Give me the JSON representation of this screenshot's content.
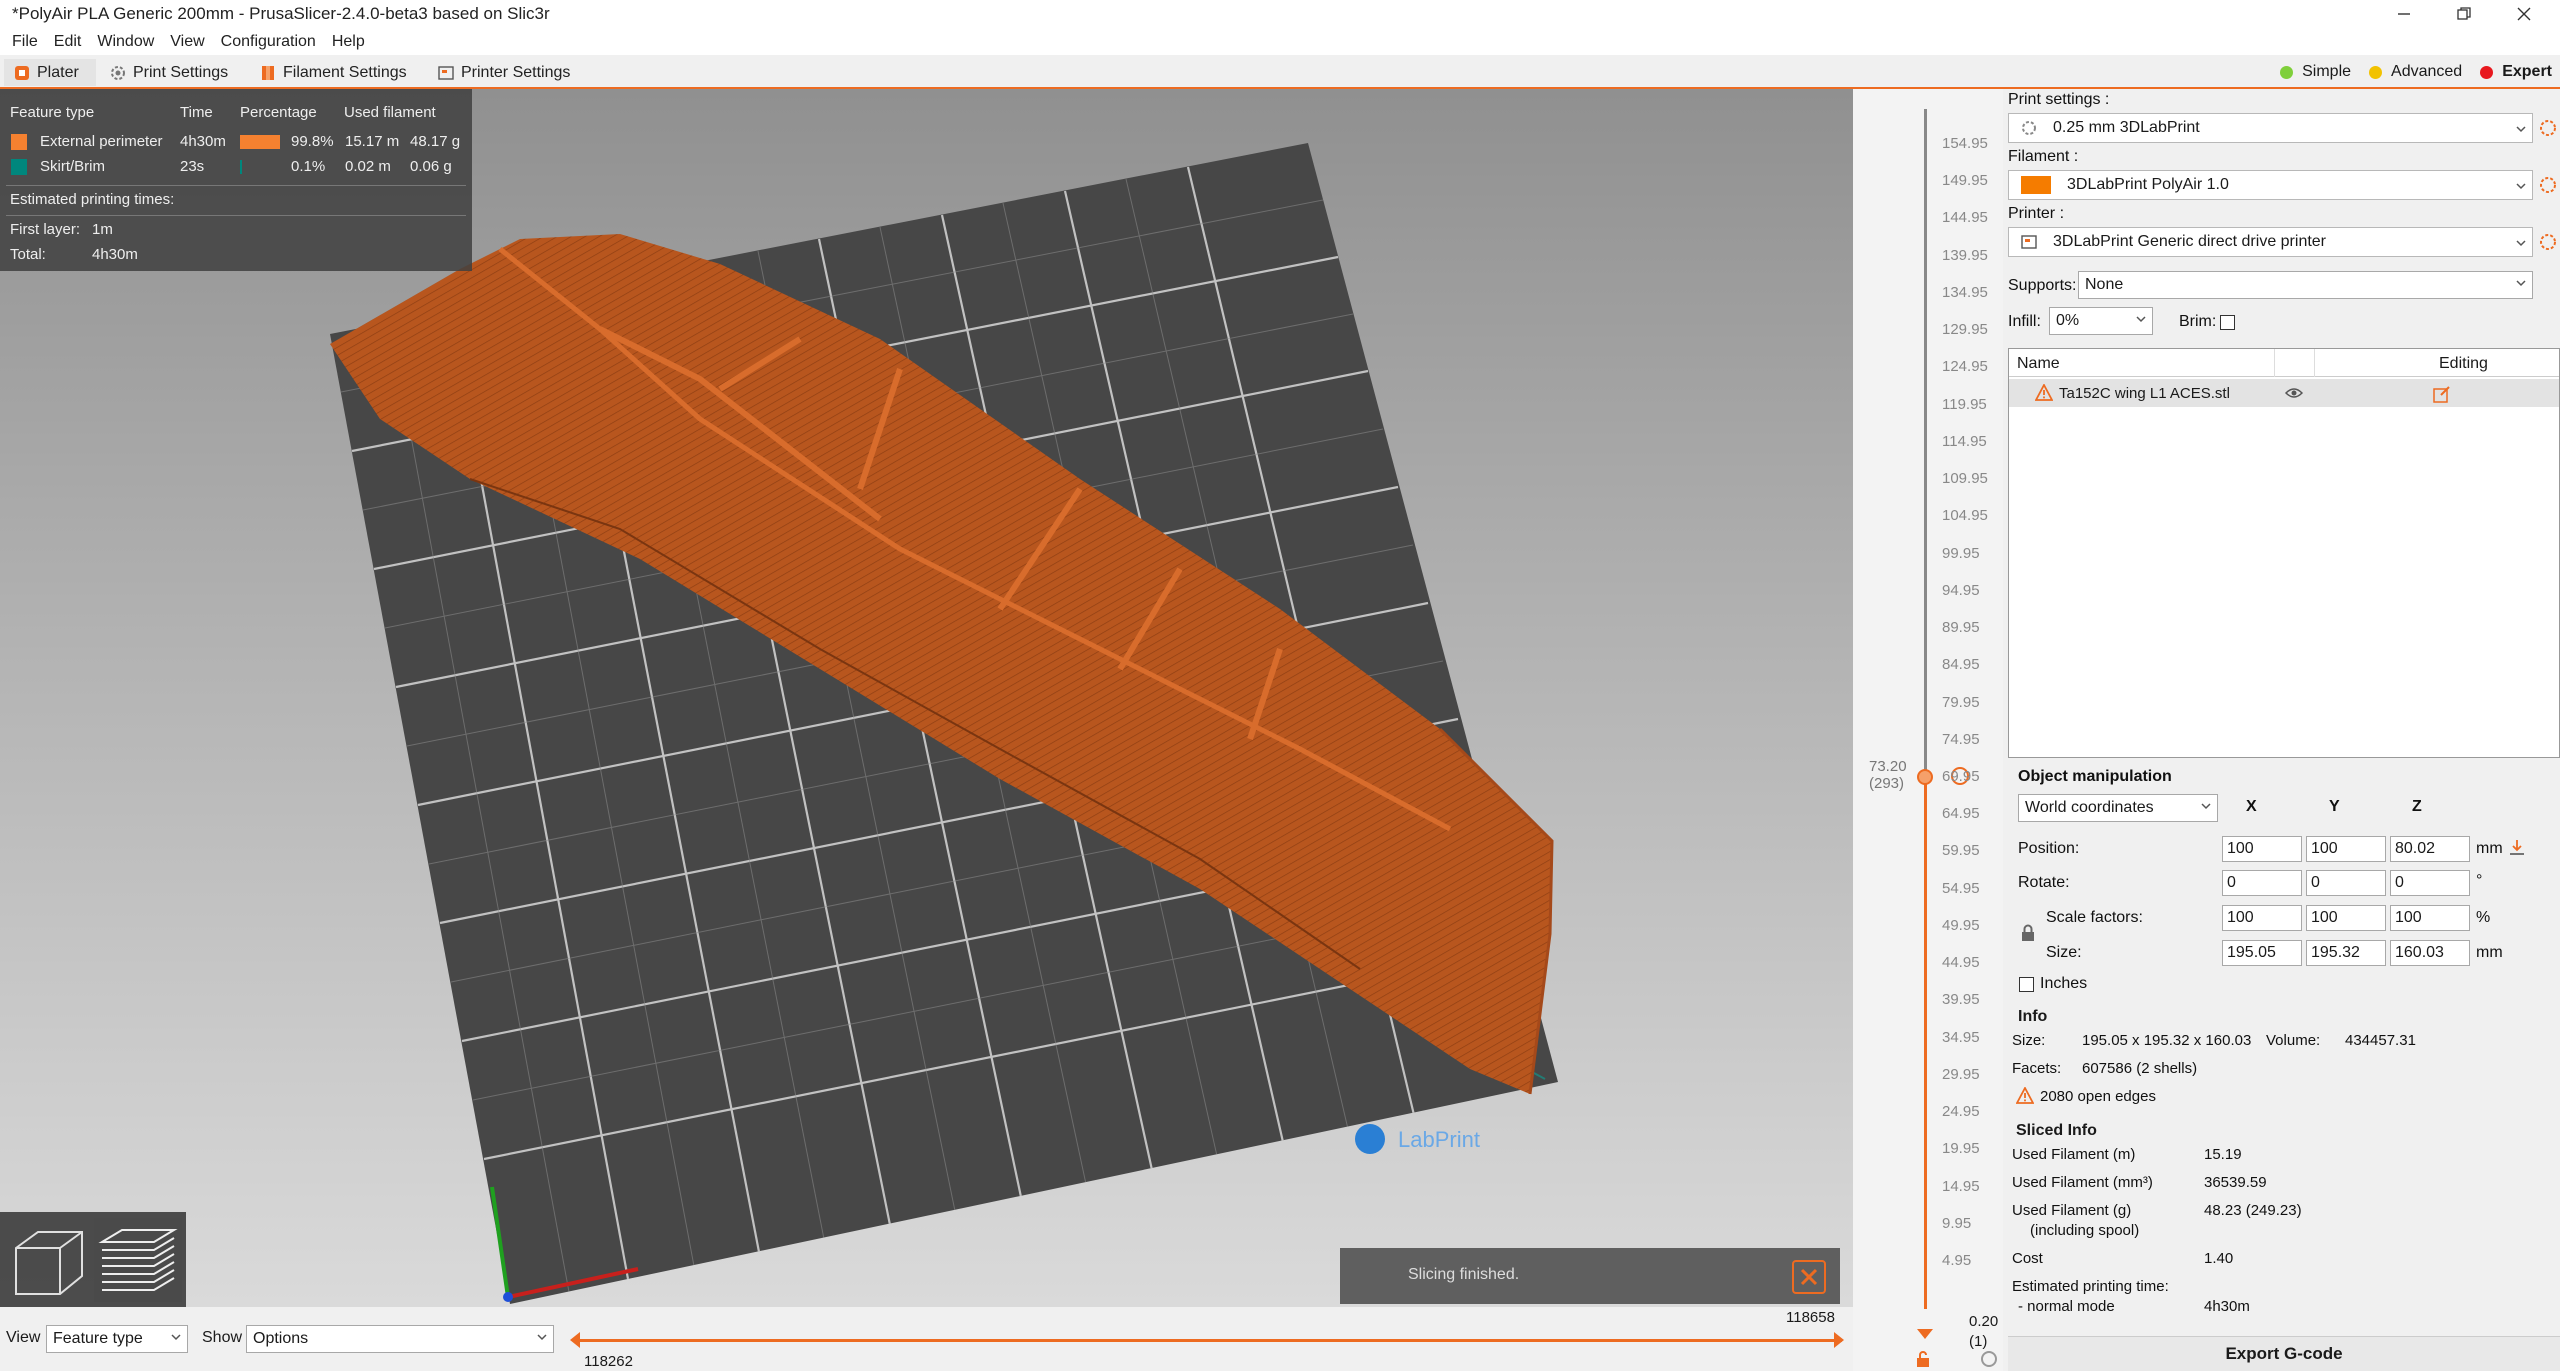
{
  "window": {
    "title": "*PolyAir PLA Generic 200mm - PrusaSlicer-2.4.0-beta3 based on Slic3r"
  },
  "menu": [
    "File",
    "Edit",
    "Window",
    "View",
    "Configuration",
    "Help"
  ],
  "tabs": [
    {
      "label": "Plater",
      "icon": "plater-icon"
    },
    {
      "label": "Print Settings",
      "icon": "gear-icon"
    },
    {
      "label": "Filament Settings",
      "icon": "spool-icon"
    },
    {
      "label": "Printer Settings",
      "icon": "printer-icon"
    }
  ],
  "modes": [
    {
      "label": "Simple",
      "color": "#7fcf3a"
    },
    {
      "label": "Advanced",
      "color": "#f2c200"
    },
    {
      "label": "Expert",
      "color": "#e8181e"
    }
  ],
  "legend": {
    "headers": [
      "Feature type",
      "Time",
      "Percentage",
      "Used filament"
    ],
    "rows": [
      {
        "name": "External perimeter",
        "time": "4h30m",
        "percent": 0.998,
        "percent_label": "99.8%",
        "length": "15.17 m",
        "weight": "48.17 g",
        "color": "#f58130"
      },
      {
        "name": "Skirt/Brim",
        "time": "23s",
        "percent": 0.001,
        "percent_label": "0.1%",
        "length": "0.02 m",
        "weight": "0.06 g",
        "color": "#00877d"
      }
    ],
    "estimated_label": "Estimated printing times:",
    "first_layer_label": "First layer:",
    "first_layer_value": "1m",
    "total_label": "Total:",
    "total_value": "4h30m"
  },
  "viewport": {
    "logo_text": "LabPrint",
    "notification": "Slicing finished."
  },
  "bottom": {
    "view_label": "View",
    "view_value": "Feature type",
    "show_label": "Show",
    "show_value": "Options",
    "slider_max": "118658",
    "slider_min": "118262"
  },
  "layer_slider": {
    "ticks": [
      "154.95",
      "149.95",
      "144.95",
      "139.95",
      "134.95",
      "129.95",
      "124.95",
      "119.95",
      "114.95",
      "109.95",
      "104.95",
      "99.95",
      "94.95",
      "89.95",
      "84.95",
      "79.95",
      "74.95",
      "69.95",
      "64.95",
      "59.95",
      "54.95",
      "49.95",
      "44.95",
      "39.95",
      "34.95",
      "29.95",
      "24.95",
      "19.95",
      "14.95",
      "9.95",
      "4.95"
    ],
    "bottom_value": "0.20",
    "bottom_index": "(1)",
    "current_value": "73.20",
    "current_index": "(293)"
  },
  "panel": {
    "print_settings_label": "Print settings :",
    "print_settings_value": "0.25 mm 3DLabPrint",
    "filament_label": "Filament :",
    "filament_value": "3DLabPrint PolyAir 1.0",
    "filament_color": "#f57c00",
    "printer_label": "Printer :",
    "printer_value": "3DLabPrint Generic direct drive printer",
    "supports_label": "Supports:",
    "supports_value": "None",
    "infill_label": "Infill:",
    "infill_value": "0%",
    "brim_label": "Brim:",
    "objects": {
      "name_header": "Name",
      "editing_header": "Editing",
      "items": [
        {
          "name": "Ta152C wing L1 ACES.stl"
        }
      ]
    },
    "manipulation": {
      "title": "Object manipulation",
      "coords": "World coordinates",
      "axes": [
        "X",
        "Y",
        "Z"
      ],
      "position_label": "Position:",
      "position": [
        "100",
        "100",
        "80.02"
      ],
      "position_unit": "mm",
      "rotate_label": "Rotate:",
      "rotate": [
        "0",
        "0",
        "0"
      ],
      "rotate_unit": "°",
      "scale_label": "Scale factors:",
      "scale": [
        "100",
        "100",
        "100"
      ],
      "scale_unit": "%",
      "size_label": "Size:",
      "size": [
        "195.05",
        "195.32",
        "160.03"
      ],
      "size_unit": "mm",
      "inches_label": "Inches"
    },
    "info": {
      "title": "Info",
      "size_label": "Size:",
      "size_value": "195.05 x 195.32 x 160.03",
      "volume_label": "Volume:",
      "volume_value": "434457.31",
      "facets_label": "Facets:",
      "facets_value": "607586 (2 shells)",
      "warning": "2080 open edges"
    },
    "sliced": {
      "title": "Sliced Info",
      "rows": [
        {
          "label": "Used Filament (m)",
          "value": "15.19"
        },
        {
          "label": "Used Filament (mm³)",
          "value": "36539.59"
        },
        {
          "label": "Used Filament (g)",
          "sublabel": "(including spool)",
          "value": "48.23 (249.23)"
        },
        {
          "label": "Cost",
          "value": "1.40"
        },
        {
          "label": "Estimated printing time:",
          "sublabel": "- normal mode",
          "value": "4h30m"
        }
      ]
    },
    "export_label": "Export G-code"
  }
}
